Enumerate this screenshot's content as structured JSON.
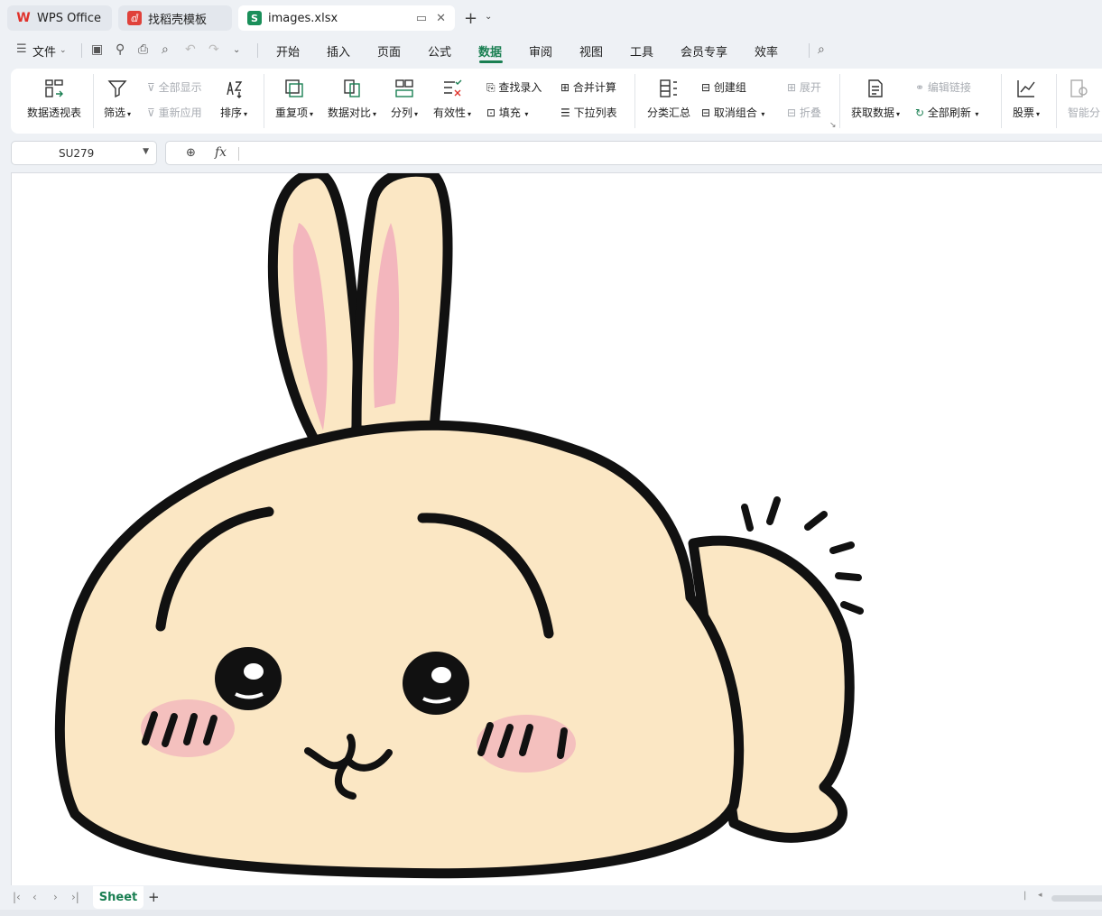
{
  "tabs": [
    {
      "label": "WPS Office",
      "icon": "wps-logo-icon"
    },
    {
      "label": "找稻壳模板",
      "icon": "docer-icon"
    },
    {
      "label": "images.xlsx",
      "icon": "spreadsheet-icon"
    }
  ],
  "menu": {
    "file": "文件",
    "items": [
      "开始",
      "插入",
      "页面",
      "公式",
      "数据",
      "审阅",
      "视图",
      "工具",
      "会员专享",
      "效率"
    ],
    "active": "数据"
  },
  "ribbon": {
    "pivot": "数据透视表",
    "filter": "筛选",
    "show_all": "全部显示",
    "reapply": "重新应用",
    "sort": "排序",
    "duplicates": "重复项",
    "compare": "数据对比",
    "split": "分列",
    "validity": "有效性",
    "lookup_entry": "查找录入",
    "fill": "填充",
    "consolidate": "合并计算",
    "dropdown_list": "下拉列表",
    "subtotal": "分类汇总",
    "group": "创建组",
    "ungroup": "取消组合",
    "expand": "展开",
    "collapse": "折叠",
    "get_data": "获取数据",
    "edit_links": "编辑链接",
    "refresh_all": "全部刷新",
    "stocks": "股票",
    "smart": "智能分"
  },
  "formula": {
    "cell_ref": "SU279",
    "fx": "fx",
    "value": ""
  },
  "sheets": {
    "active": "Sheet"
  },
  "colors": {
    "accent": "#1a7f52",
    "bunny_body": "#fbe7c4",
    "bunny_pink": "#f3b6bd"
  }
}
